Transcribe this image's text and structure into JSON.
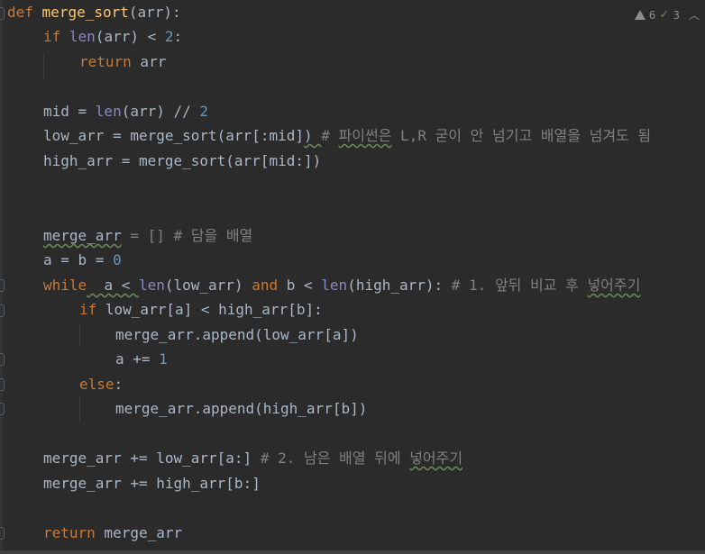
{
  "inspection": {
    "warnings_count": "6",
    "weak_warnings_count": "3"
  },
  "code": {
    "l1_def": "def",
    "l1_name": "merge_sort",
    "l1_rest": "(arr):",
    "l2_if": "if",
    "l2_len": "len",
    "l2_mid": "(arr) < ",
    "l2_num": "2",
    "l2_end": ":",
    "l3_return": "return",
    "l3_rest": " arr",
    "l5_a": "mid = ",
    "l5_len": "len",
    "l5_b": "(arr) // ",
    "l5_num": "2",
    "l6_a": "low_arr = merge_sort(arr[:mid]",
    "l6_paren": ")",
    "l6_space": " ",
    "l6_cm1": "# ",
    "l6_cm2": "파이썬은",
    "l6_cm3": " L,R 굳이 안 넘기고 배열을 넘겨도 됨",
    "l7": "high_arr = merge_sort(arr[mid:])",
    "l10_a": "merge_arr",
    "l10_b": " = [] # 담을 배열",
    "l11_a": "a = b = ",
    "l11_num": "0",
    "l12_while": "while",
    "l12_a": "  a < ",
    "l12_len1": "len",
    "l12_b": "(low_arr) ",
    "l12_and": "and",
    "l12_c": " b < ",
    "l12_len2": "len",
    "l12_d": "(high_arr):",
    "l12_cm1": " # 1. 앞뒤 비교 후 ",
    "l12_cm2": "넣어주기",
    "l13_if": "if",
    "l13_rest": " low_arr[a] < high_arr[b]:",
    "l14": "merge_arr.append(low_arr[a])",
    "l15_a": "a += ",
    "l15_num": "1",
    "l16_else": "else",
    "l16_colon": ":",
    "l17": "merge_arr.append(high_arr[b])",
    "l19_a": "merge_arr += low_arr[a:]",
    "l19_cm1": " # 2. 남은 배열 뒤에 ",
    "l19_cm2": "넣어주기",
    "l20": "merge_arr += high_arr[b:]",
    "l22_return": "return",
    "l22_rest": " merge_arr"
  },
  "colors": {
    "background": "#2b2b2b",
    "keyword": "#cc7832",
    "function": "#ffc66d",
    "builtin": "#8888c6",
    "number": "#6897bb",
    "comment": "#808080",
    "text": "#a9b7c6"
  }
}
